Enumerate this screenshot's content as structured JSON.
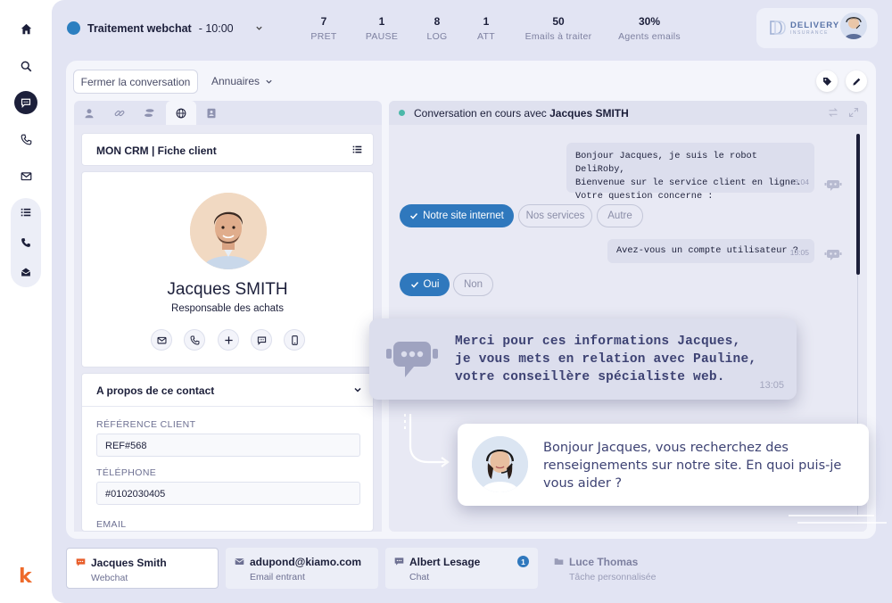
{
  "rail": {
    "icons": [
      "home-icon",
      "search-icon",
      "chat-icon",
      "phone-icon",
      "mail-icon",
      "list-icon",
      "phone-outline-icon",
      "mail-open-icon"
    ],
    "logo": "k"
  },
  "status": {
    "label": "Traitement webchat",
    "time": "- 10:00",
    "color": "#2c7fc0"
  },
  "stats": [
    {
      "value": "7",
      "label": "PRET"
    },
    {
      "value": "1",
      "label": "PAUSE"
    },
    {
      "value": "8",
      "label": "LOG"
    },
    {
      "value": "1",
      "label": "ATT"
    },
    {
      "value": "50",
      "label": "Emails à traiter"
    },
    {
      "value": "30%",
      "label": "Agents emails"
    }
  ],
  "brand": {
    "name": "DELIVERY",
    "sub": "INSURANCE"
  },
  "toolbar": {
    "close_label": "Fermer la conversation",
    "directory_label": "Annuaires"
  },
  "left_panel": {
    "tabs": [
      "user-icon",
      "link-icon",
      "footprint-icon",
      "globe-icon",
      "contact-card-icon"
    ],
    "crm_title": "MON CRM  | Fiche client",
    "profile": {
      "name": "Jacques SMITH",
      "role": "Responsable des achats"
    },
    "about": {
      "title": "A propos de ce contact",
      "fields": [
        {
          "label": "RÉFÉRENCE CLIENT",
          "value": "REF#568"
        },
        {
          "label": "TÉLÉPHONE",
          "value": "#0102030405"
        },
        {
          "label": "EMAIL",
          "value": ""
        }
      ]
    }
  },
  "chat": {
    "header_prefix": "Conversation en cours avec ",
    "header_name": "Jacques SMITH",
    "messages": [
      {
        "lines": [
          "Bonjour Jacques, je suis le robot DeliRoby,",
          "Bienvenue sur le service client en ligne.",
          "Votre question concerne :"
        ],
        "time": "13:04"
      },
      {
        "lines": [
          "Avez-vous un compte utilisateur ?"
        ],
        "time": "13:05"
      }
    ],
    "choices_1": [
      "Notre site internet",
      "Nos services",
      "Autre"
    ],
    "choices_2": [
      "Oui",
      "Non"
    ],
    "accent": "#2f78bd"
  },
  "overlay_bot": {
    "lines": [
      "Merci pour ces informations Jacques,",
      "je vous mets en relation avec Pauline,",
      "votre conseillère spécialiste web."
    ],
    "time": "13:05"
  },
  "overlay_agent": {
    "lines": [
      "Bonjour Jacques, vous recherchez des",
      "renseignements sur notre site. En quoi puis-je",
      "vous aider ?"
    ]
  },
  "sessions": [
    {
      "name": "Jacques Smith",
      "type": "Webchat",
      "icon": "chat-icon"
    },
    {
      "name": "adupond@kiamo.com",
      "type": "Email entrant",
      "icon": "mail-icon"
    },
    {
      "name": "Albert Lesage",
      "type": "Chat",
      "icon": "chat-icon",
      "badge": "1"
    },
    {
      "name": "Luce Thomas",
      "type": "Tâche personnalisée",
      "icon": "folder-icon"
    }
  ]
}
